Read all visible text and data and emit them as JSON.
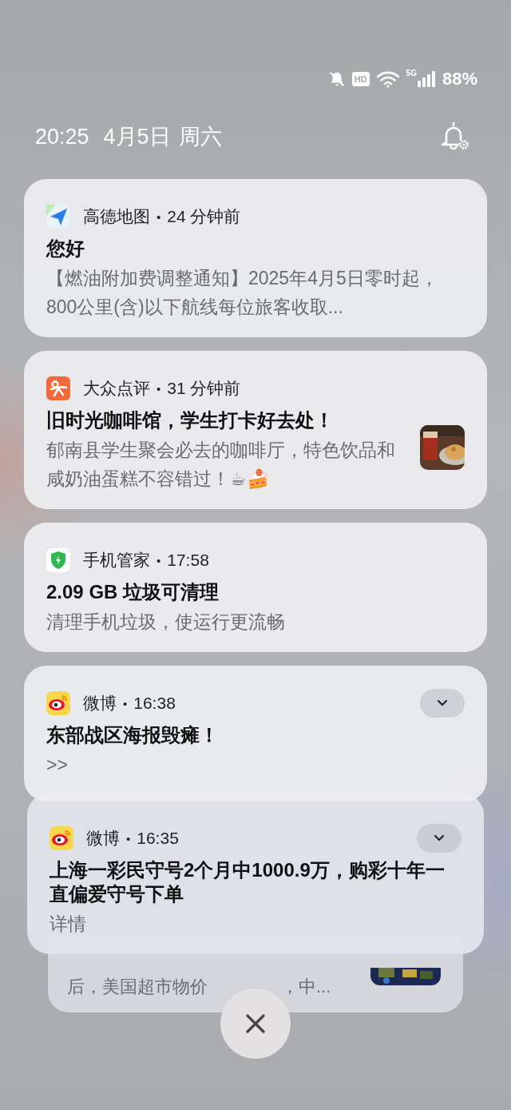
{
  "status_bar": {
    "hd": "HD",
    "network": "5G",
    "battery": "88%"
  },
  "header": {
    "time": "20:25",
    "date": "4月5日",
    "weekday": "周六"
  },
  "notifications": [
    {
      "kind": "map",
      "app": "高德地图",
      "separator": "•",
      "time": "24 分钟前",
      "title": "您好",
      "body": "【燃油附加费调整通知】2025年4月5日零时起，800公里(含)以下航线每位旅客收取...",
      "thumbnail": false,
      "expand_button": false
    },
    {
      "kind": "review",
      "app": "大众点评",
      "separator": "•",
      "time": "31 分钟前",
      "title": "旧时光咖啡馆，学生打卡好去处！",
      "body": "郁南县学生聚会必去的咖啡厅，特色饮品和咸奶油蛋糕不容错过！☕🍰",
      "thumbnail": true,
      "expand_button": false
    },
    {
      "kind": "shield",
      "app": "手机管家",
      "separator": "•",
      "time": "17:58",
      "title": "2.09 GB 垃圾可清理",
      "body": "清理手机垃圾，使运行更流畅",
      "thumbnail": false,
      "expand_button": false
    },
    {
      "kind": "weibo",
      "app": "微博",
      "separator": "•",
      "time": "16:38",
      "title": "东部战区海报毁瘫！",
      "body": ">>",
      "thumbnail": false,
      "expand_button": true
    },
    {
      "kind": "weibo",
      "app": "微博",
      "separator": "•",
      "time": "16:35",
      "title": "上海一彩民守号2个月中1000.9万，购彩十年一直偏爱守号下单",
      "body": "详情",
      "thumbnail": false,
      "expand_button": true
    }
  ],
  "stacked_card": {
    "text_left": "后，美国超市物价",
    "text_right": "，中...",
    "thumbnail": true
  }
}
